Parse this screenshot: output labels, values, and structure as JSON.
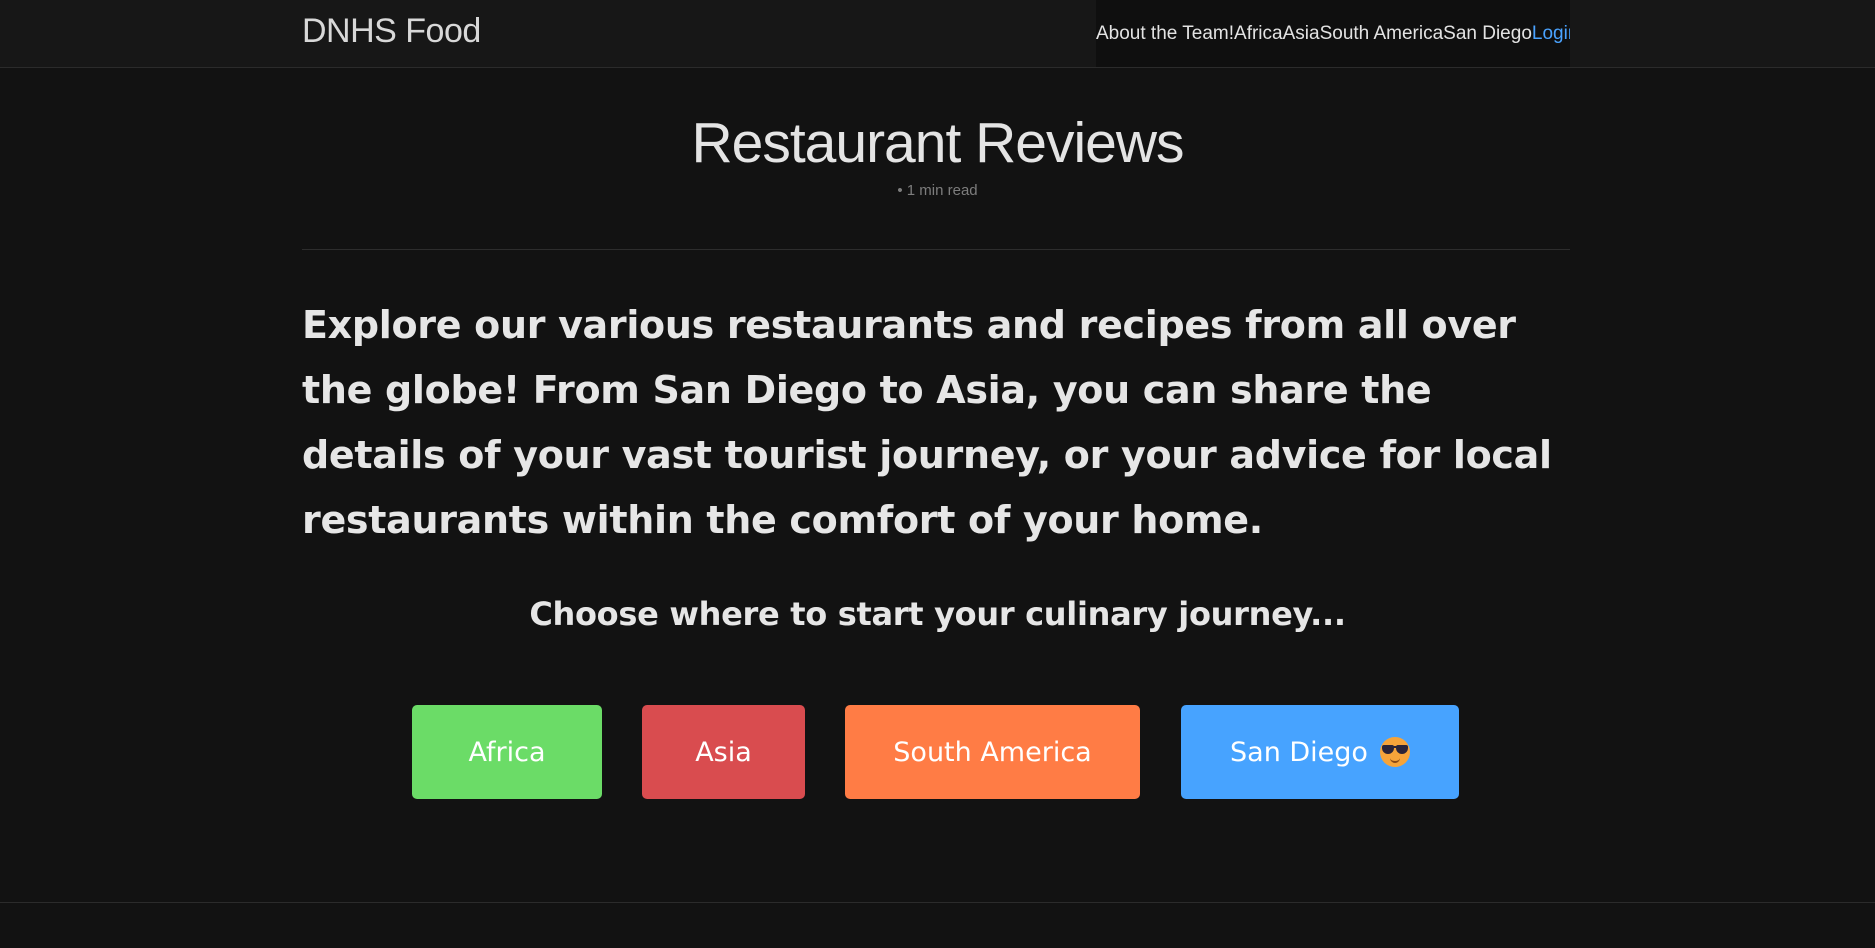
{
  "header": {
    "site_title": "DNHS Food",
    "nav": [
      {
        "label": "About the Team!"
      },
      {
        "label": "Africa"
      },
      {
        "label": "Asia"
      },
      {
        "label": "South America"
      },
      {
        "label": "San Diego"
      },
      {
        "label": "Login"
      }
    ]
  },
  "main": {
    "title": "Restaurant Reviews",
    "meta": "• 1 min read",
    "intro": "Explore our various restaurants and recipes from all over the globe! From San Diego to Asia, you can share the details of your vast tourist journey, or your advice for local restaurants within the comfort of your home.",
    "choose_heading": "Choose where to start your culinary journey...",
    "buttons": [
      {
        "label": "Africa",
        "color": "#6bdc67"
      },
      {
        "label": "Asia",
        "color": "#d94c4f"
      },
      {
        "label": "South America",
        "color": "#ff7c45"
      },
      {
        "label": "San Diego",
        "color": "#47a3ff",
        "icon": "sunglasses-face-icon"
      }
    ]
  },
  "colors": {
    "background": "#121212",
    "header_background": "#171717",
    "text": "#e6e6e6",
    "link_accent": "#4aa3ff"
  }
}
